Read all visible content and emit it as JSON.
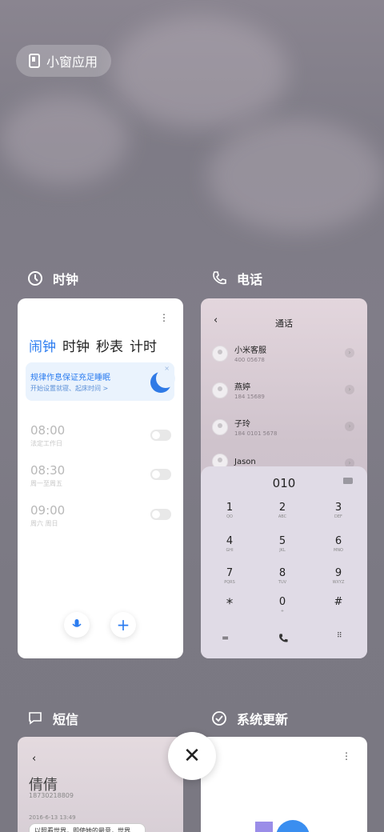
{
  "pill_label": "小窗应用",
  "apps": {
    "clock": {
      "name": "时钟",
      "tabs": [
        "闹钟",
        "时钟",
        "秒表",
        "计时"
      ],
      "banner_title": "规律作息保证充足睡眠",
      "banner_sub": "开始设置就寝、起床时间 >",
      "alarms": [
        {
          "time": "08:00",
          "label": "法定工作日"
        },
        {
          "time": "08:30",
          "label": "周一至周五"
        },
        {
          "time": "09:00",
          "label": "周六 周日"
        }
      ]
    },
    "phone": {
      "name": "电话",
      "title": "通话",
      "contacts": [
        {
          "name": "小米客服",
          "number": "400 05678"
        },
        {
          "name": "燕婷",
          "number": "184 15689"
        },
        {
          "name": "子玲",
          "number": "184 0101 5678"
        },
        {
          "name": "Jason",
          "number": ""
        }
      ],
      "dial_number": "010",
      "keys": [
        {
          "d": "1",
          "l": "QO"
        },
        {
          "d": "2",
          "l": "ABC"
        },
        {
          "d": "3",
          "l": "DEF"
        },
        {
          "d": "4",
          "l": "GHI"
        },
        {
          "d": "5",
          "l": "JKL"
        },
        {
          "d": "6",
          "l": "MNO"
        },
        {
          "d": "7",
          "l": "PQRS"
        },
        {
          "d": "8",
          "l": "TUV"
        },
        {
          "d": "9",
          "l": "WXYZ"
        },
        {
          "d": "*",
          "l": ""
        },
        {
          "d": "0",
          "l": "+"
        },
        {
          "d": "#",
          "l": ""
        }
      ]
    },
    "sms": {
      "name": "短信",
      "contact": "倩倩",
      "number": "18730218809",
      "date": "2016-6-13 13:49",
      "preview": "以照看世界，即使她的最意，世界"
    },
    "update": {
      "name": "系统更新"
    }
  }
}
